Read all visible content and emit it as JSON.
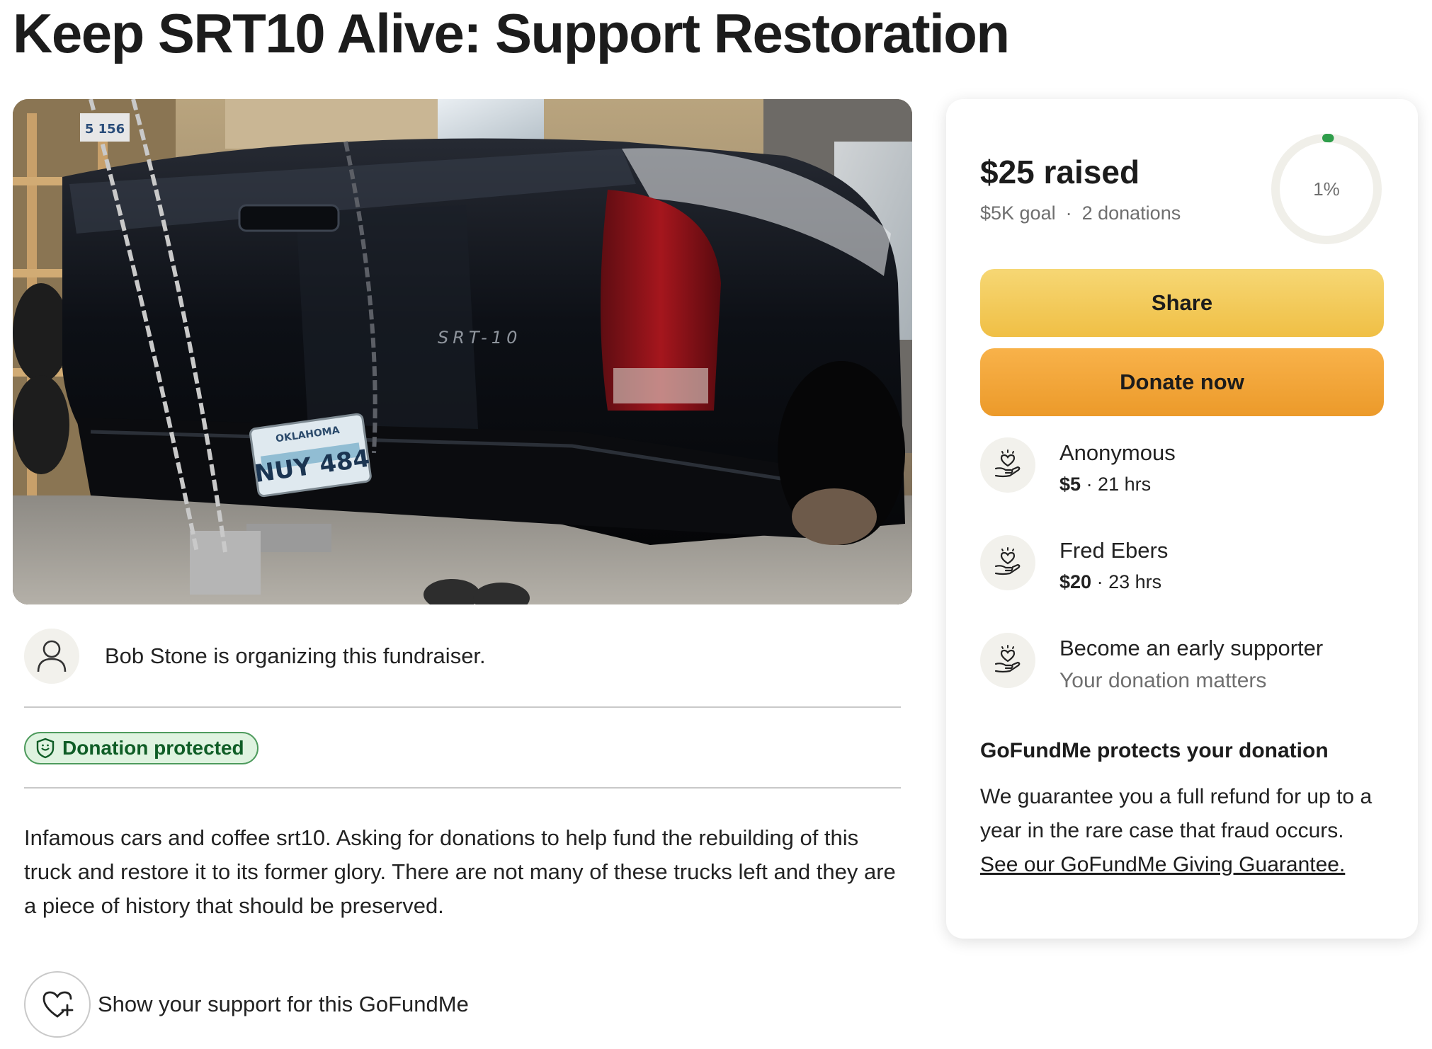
{
  "title": "Keep SRT10 Alive: Support Restoration",
  "hero_image": {
    "plate_state": "OKLAHOMA",
    "plate_number": "NUY 484",
    "badge": "SRT-10",
    "garage_tag": "5 156"
  },
  "organizer": {
    "text": "Bob Stone is organizing this fundraiser.",
    "icon": "person-icon"
  },
  "protection_badge": {
    "label": "Donation protected",
    "icon": "shield-icon",
    "color": "#0f5d26"
  },
  "story": "Infamous cars and coffee srt10. Asking for donations to help fund the rebuilding of this truck and restore it to its former glory. There are not many of these trucks left and they are a piece of history that should be preserved.",
  "support": {
    "label": "Show your support for this GoFundMe",
    "icon": "heart-plus-icon"
  },
  "card": {
    "raised": "$25 raised",
    "goal": "$5K goal",
    "separator": "·",
    "donations": "2 donations",
    "progress_label": "1%",
    "progress_fraction": 0.01,
    "share_label": "Share",
    "donate_label": "Donate now",
    "donors": [
      {
        "name": "Anonymous",
        "amount": "$5",
        "time": "· 21 hrs",
        "icon": "donation-hand-icon"
      },
      {
        "name": "Fred Ebers",
        "amount": "$20",
        "time": "· 23 hrs",
        "icon": "donation-hand-icon"
      }
    ],
    "early_supporter": {
      "title": "Become an early supporter",
      "subtitle": "Your donation matters",
      "icon": "donation-hand-icon"
    },
    "protect_title": "GoFundMe protects your donation",
    "protect_body": "We guarantee you a full refund for up to a year in the rare case that fraud occurs.",
    "protect_link": "See our GoFundMe Giving Guarantee."
  },
  "colors": {
    "share_button": "#f0bf45",
    "donate_button": "#ec9a2a",
    "progress_accent": "#2e9d4a",
    "badge_background": "#dff3e0"
  }
}
